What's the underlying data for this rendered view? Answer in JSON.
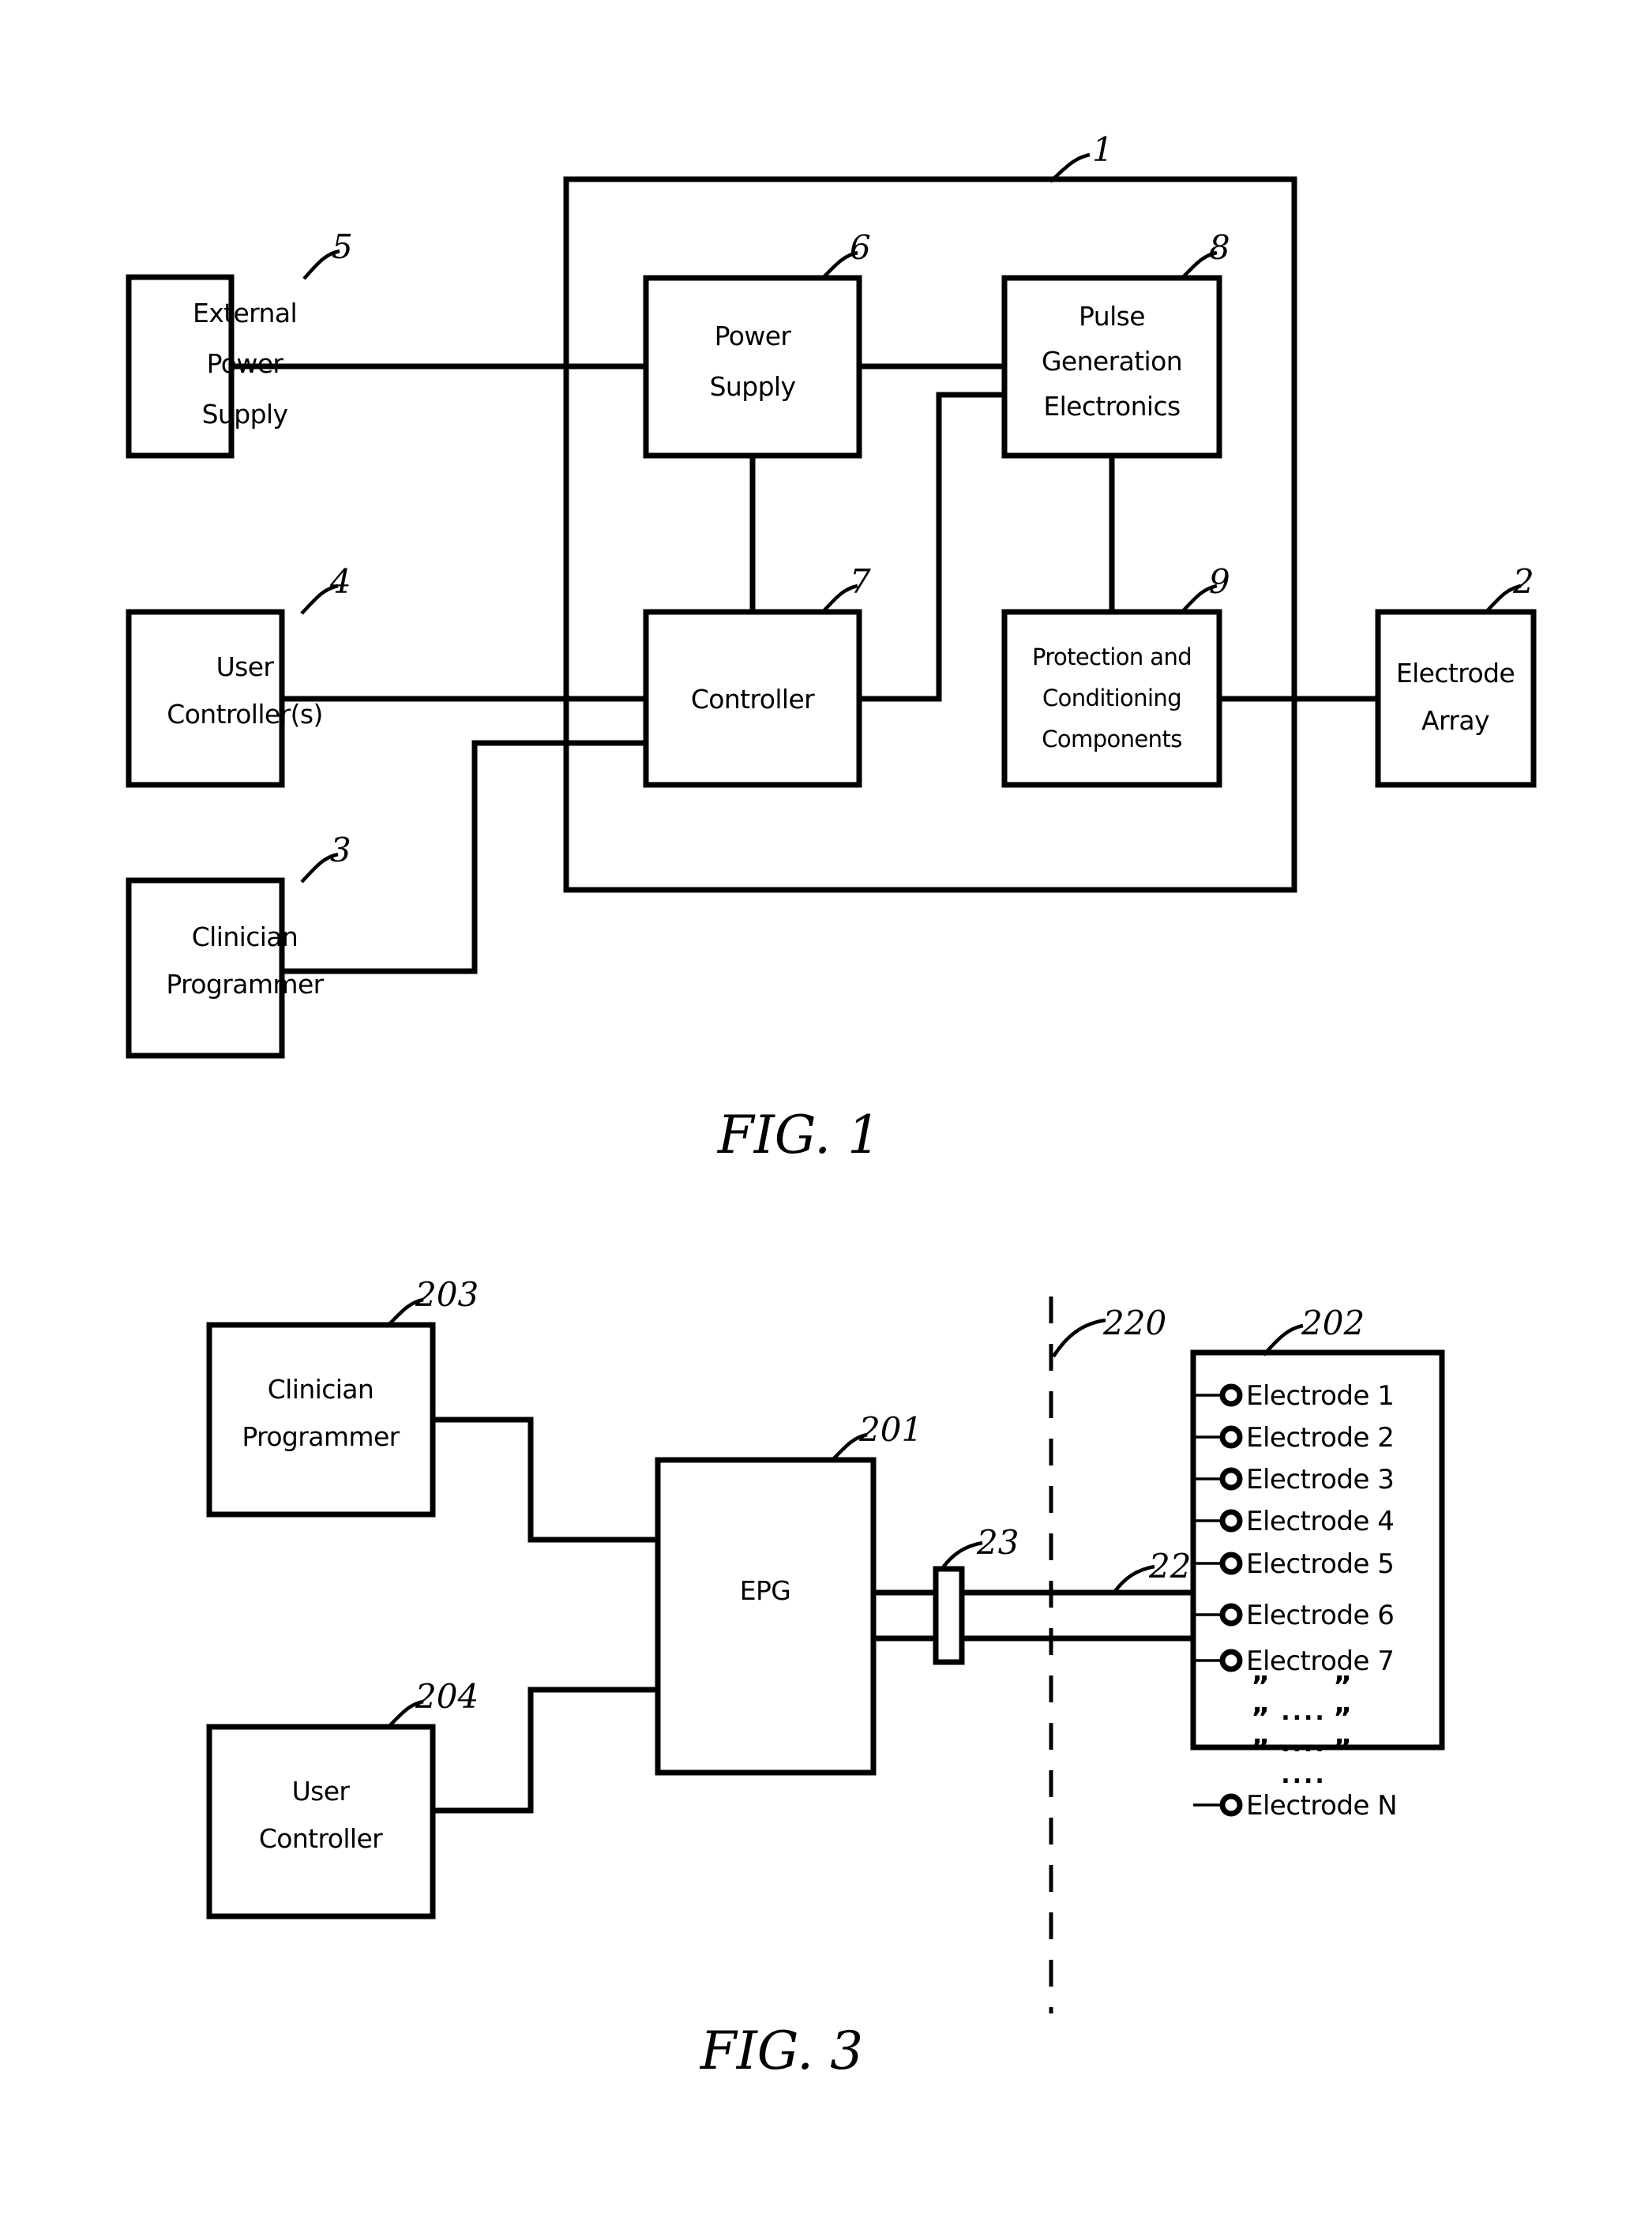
{
  "figures": [
    {
      "id": "fig1",
      "caption": "FIG. 1",
      "enclosure_ref": "1",
      "blocks": [
        {
          "key": "external_power_supply",
          "ref": "5",
          "lines": [
            "External",
            "Power",
            "Supply"
          ]
        },
        {
          "key": "power_supply",
          "ref": "6",
          "lines": [
            "Power",
            "Supply"
          ]
        },
        {
          "key": "pulse_generation",
          "ref": "8",
          "lines": [
            "Pulse",
            "Generation",
            "Electronics"
          ]
        },
        {
          "key": "user_controllers",
          "ref": "4",
          "lines": [
            "User",
            "Controller(s)"
          ]
        },
        {
          "key": "controller",
          "ref": "7",
          "lines": [
            "Controller"
          ]
        },
        {
          "key": "protection",
          "ref": "9",
          "lines": [
            "Protection  and",
            "Conditioning",
            "Components"
          ]
        },
        {
          "key": "electrode_array",
          "ref": "2",
          "lines": [
            "Electrode",
            "Array"
          ]
        },
        {
          "key": "clinician_programmer",
          "ref": "3",
          "lines": [
            "Clinician",
            "Programmer"
          ]
        }
      ]
    },
    {
      "id": "fig3",
      "caption": "FIG. 3",
      "blocks": [
        {
          "key": "clinician_programmer",
          "ref": "203",
          "lines": [
            "Clinician",
            "Programmer"
          ]
        },
        {
          "key": "epg",
          "ref": "201",
          "lines": [
            "EPG"
          ]
        },
        {
          "key": "user_controller",
          "ref": "204",
          "lines": [
            "User",
            "Controller"
          ]
        },
        {
          "key": "electrode_array",
          "ref": "202",
          "lines": []
        }
      ],
      "connector_ref": "23",
      "lead_ref": "22",
      "boundary_ref": "220",
      "electrodes": [
        "Electrode  1",
        "Electrode  2",
        "Electrode  3",
        "Electrode  4",
        "Electrode  5",
        "Electrode  6",
        "Electrode  7",
        "Electrode  N"
      ],
      "ellipsis_mark": "”",
      "ellipsis_dots": "...."
    }
  ],
  "colors": {
    "ink": "#000000",
    "paper": "#ffffff"
  }
}
